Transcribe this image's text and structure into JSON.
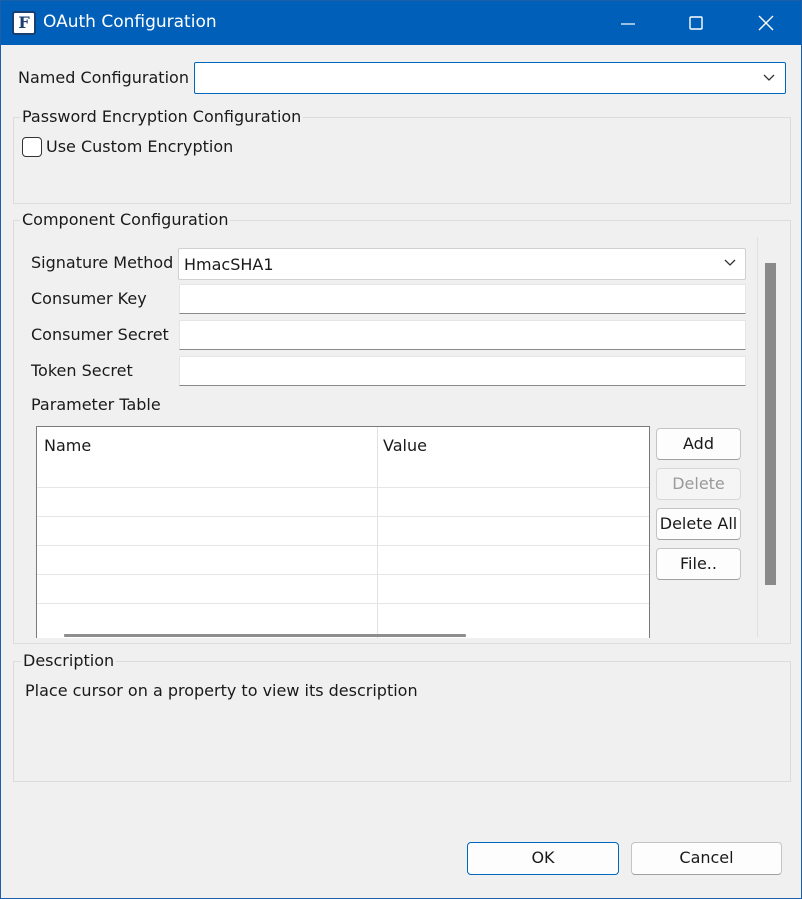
{
  "window": {
    "title": "OAuth Configuration",
    "app_icon_letter": "F",
    "accent_color": "#005fb8"
  },
  "named_configuration": {
    "label": "Named Configuration",
    "value": ""
  },
  "password_encryption": {
    "title": "Password Encryption Configuration",
    "use_custom_label": "Use Custom Encryption",
    "use_custom_checked": false
  },
  "component": {
    "title": "Component Configuration",
    "signature_method": {
      "label": "Signature Method",
      "value": "HmacSHA1"
    },
    "consumer_key": {
      "label": "Consumer Key",
      "value": ""
    },
    "consumer_secret": {
      "label": "Consumer Secret",
      "value": ""
    },
    "token_secret": {
      "label": "Token Secret",
      "value": ""
    },
    "parameter_table": {
      "label": "Parameter Table",
      "columns": [
        "Name",
        "Value"
      ],
      "rows": []
    },
    "buttons": {
      "add": "Add",
      "delete": "Delete",
      "delete_all": "Delete All",
      "file": "File.."
    }
  },
  "description": {
    "title": "Description",
    "text": "Place cursor on a property to view its description"
  },
  "footer": {
    "ok": "OK",
    "cancel": "Cancel"
  },
  "icons": [
    "app-icon",
    "minimize-icon",
    "maximize-icon",
    "close-icon",
    "chevron-down-icon",
    "checkbox"
  ]
}
